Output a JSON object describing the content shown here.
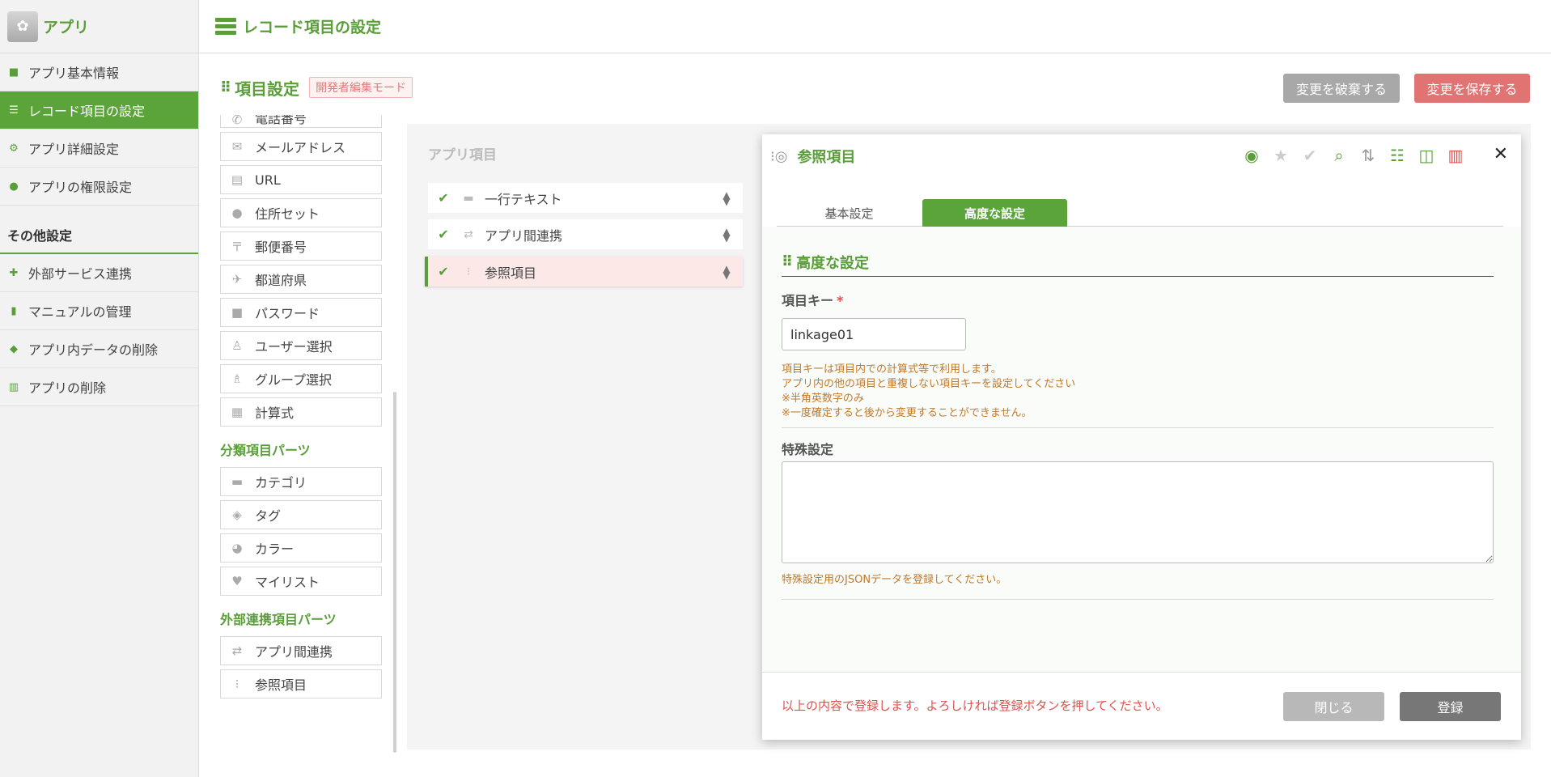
{
  "sidebar": {
    "app_name": "アプリ",
    "items": [
      {
        "label": "アプリ基本情報"
      },
      {
        "label": "レコード項目の設定"
      },
      {
        "label": "アプリ詳細設定"
      },
      {
        "label": "アプリの権限設定"
      }
    ],
    "section_title": "その他設定",
    "other_items": [
      {
        "label": "外部サービス連携"
      },
      {
        "label": "マニュアルの管理"
      },
      {
        "label": "アプリ内データの削除"
      },
      {
        "label": "アプリの削除"
      }
    ]
  },
  "header": {
    "title": "レコード項目の設定"
  },
  "section": {
    "title": "項目設定",
    "mode_badge": "開発者編集モード"
  },
  "actions": {
    "discard_label": "変更を破棄する",
    "save_label": "変更を保存する"
  },
  "palette": {
    "cut_item": "電話番号",
    "basic_parts": [
      {
        "label": "メールアドレス",
        "icon": "envelope-icon"
      },
      {
        "label": "URL",
        "icon": "browser-icon"
      },
      {
        "label": "住所セット",
        "icon": "map-pin-icon"
      },
      {
        "label": "郵便番号",
        "icon": "postal-icon"
      },
      {
        "label": "都道府県",
        "icon": "japan-map-icon"
      },
      {
        "label": "パスワード",
        "icon": "lock-icon"
      },
      {
        "label": "ユーザー選択",
        "icon": "user-icon"
      },
      {
        "label": "グループ選択",
        "icon": "group-icon"
      },
      {
        "label": "計算式",
        "icon": "calculator-icon"
      }
    ],
    "category_title": "分類項目パーツ",
    "category_parts": [
      {
        "label": "カテゴリ",
        "icon": "folder-icon"
      },
      {
        "label": "タグ",
        "icon": "tag-icon"
      },
      {
        "label": "カラー",
        "icon": "palette-icon"
      },
      {
        "label": "マイリスト",
        "icon": "heart-icon"
      }
    ],
    "external_title": "外部連携項目パーツ",
    "external_parts": [
      {
        "label": "アプリ間連携",
        "icon": "exchange-icon"
      },
      {
        "label": "参照項目",
        "icon": "reference-icon"
      }
    ]
  },
  "canvas": {
    "heading": "アプリ項目",
    "fields": [
      {
        "label": "一行テキスト"
      },
      {
        "label": "アプリ間連携"
      },
      {
        "label": "参照項目"
      }
    ]
  },
  "dialog": {
    "title": "参照項目",
    "tabs": {
      "basic": "基本設定",
      "advanced": "高度な設定"
    },
    "advanced_heading": "高度な設定",
    "field_key_label": "項目キー",
    "required_mark": "*",
    "field_key_value": "linkage01",
    "field_key_help": [
      "項目キーは項目内での計算式等で利用します。",
      "アプリ内の他の項目と重複しない項目キーを設定してください",
      "※半角英数字のみ",
      "※一度確定すると後から変更することができません。"
    ],
    "special_label": "特殊設定",
    "special_help": "特殊設定用のJSONデータを登録してください。",
    "footer_message": "以上の内容で登録します。よろしければ登録ボタンを押してください。",
    "close_label": "閉じる",
    "register_label": "登録"
  },
  "colors": {
    "accent": "#5aa43a",
    "danger": "#e17373"
  }
}
